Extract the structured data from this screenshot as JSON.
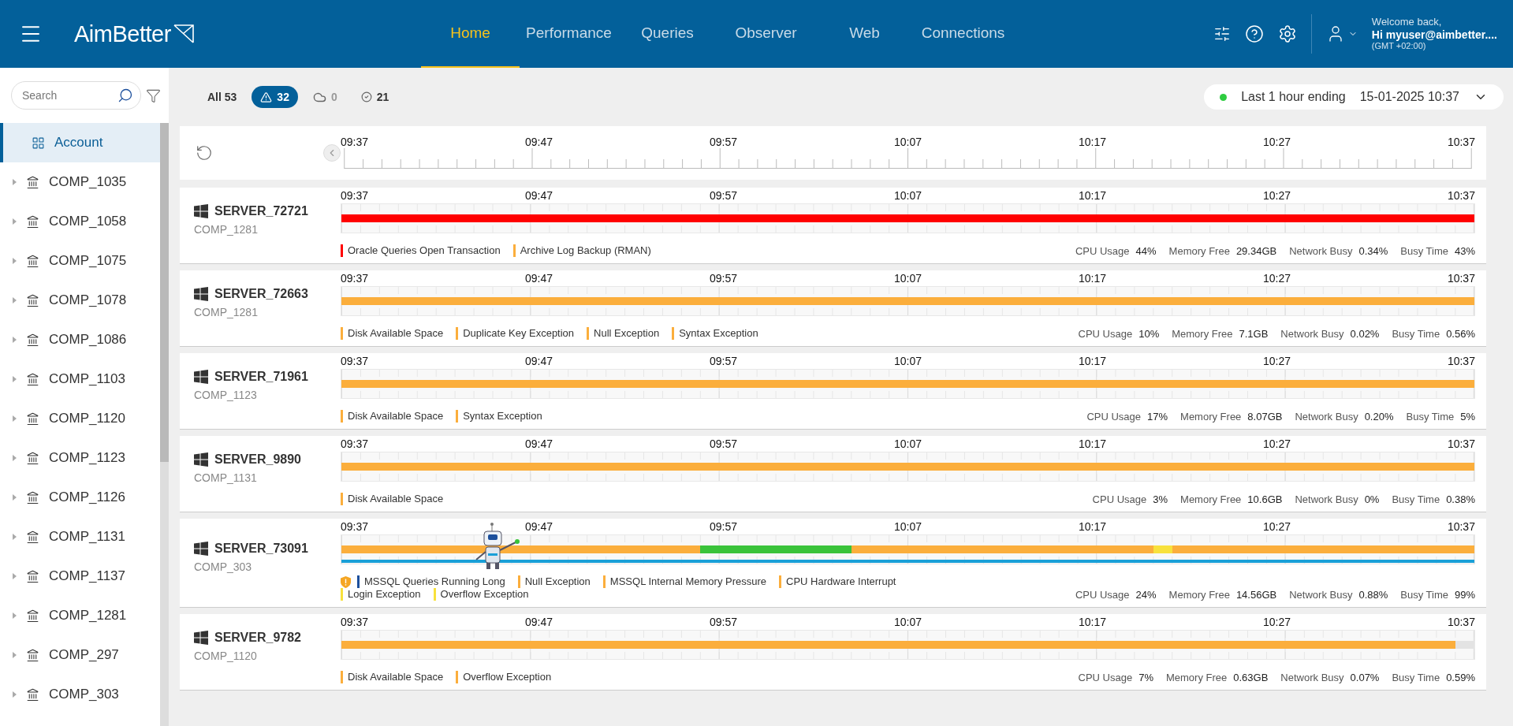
{
  "header": {
    "logo": "AimBetter",
    "nav": [
      {
        "label": "Home",
        "selected": true
      },
      {
        "label": "Performance",
        "selected": false
      },
      {
        "label": "Queries",
        "selected": false
      },
      {
        "label": "Observer",
        "selected": false
      },
      {
        "label": "Web",
        "selected": false
      },
      {
        "label": "Connections",
        "selected": false
      }
    ],
    "user": {
      "greeting": "Welcome back,",
      "name": "Hi myuser@aimbetter....",
      "timezone": "(GMT +02:00)"
    }
  },
  "sidebar": {
    "search": {
      "placeholder": "Search"
    },
    "items": [
      {
        "label": "Account",
        "kind": "account",
        "selected": true
      },
      {
        "label": "COMP_1035",
        "kind": "company",
        "selected": false
      },
      {
        "label": "COMP_1058",
        "kind": "company",
        "selected": false
      },
      {
        "label": "COMP_1075",
        "kind": "company",
        "selected": false
      },
      {
        "label": "COMP_1078",
        "kind": "company",
        "selected": false
      },
      {
        "label": "COMP_1086",
        "kind": "company",
        "selected": false
      },
      {
        "label": "COMP_1103",
        "kind": "company",
        "selected": false
      },
      {
        "label": "COMP_1120",
        "kind": "company",
        "selected": false
      },
      {
        "label": "COMP_1123",
        "kind": "company",
        "selected": false
      },
      {
        "label": "COMP_1126",
        "kind": "company",
        "selected": false
      },
      {
        "label": "COMP_1131",
        "kind": "company",
        "selected": false
      },
      {
        "label": "COMP_1137",
        "kind": "company",
        "selected": false
      },
      {
        "label": "COMP_1281",
        "kind": "company",
        "selected": false
      },
      {
        "label": "COMP_297",
        "kind": "company",
        "selected": false
      },
      {
        "label": "COMP_303",
        "kind": "company",
        "selected": false
      }
    ]
  },
  "filters": [
    {
      "kind": "all",
      "label": "All 53",
      "selected": false,
      "disabled": false
    },
    {
      "kind": "alert",
      "label": "32",
      "selected": true,
      "disabled": false
    },
    {
      "kind": "cloud",
      "label": "0",
      "selected": false,
      "disabled": true
    },
    {
      "kind": "ok",
      "label": "21",
      "selected": false,
      "disabled": false
    }
  ],
  "time_range": {
    "label": "Last 1 hour ending",
    "value": "15-01-2025 10:37",
    "live": true
  },
  "timeline": {
    "labels": [
      "09:37",
      "09:47",
      "09:57",
      "10:07",
      "10:17",
      "10:27",
      "10:37"
    ]
  },
  "servers": [
    {
      "name": "SERVER_72721",
      "company": "COMP_1281",
      "time_labels": [
        "09:37",
        "09:47",
        "09:57",
        "10:07",
        "10:17",
        "10:27",
        "10:37"
      ],
      "segments": [
        {
          "color": "#ff0000"
        },
        {
          "color": "#ff0000"
        },
        {
          "color": "#ff0000"
        },
        {
          "color": "#ff0000"
        },
        {
          "color": "#ff0000"
        },
        {
          "color": "#ff0000"
        },
        {
          "color": "#ff0000"
        },
        {
          "color": "#ff0000"
        },
        {
          "color": "#ff0000"
        },
        {
          "color": "#ff0000"
        },
        {
          "color": "#ff0000"
        },
        {
          "color": "#ff0000"
        },
        {
          "color": "#ff0000"
        },
        {
          "color": "#ff0000"
        },
        {
          "color": "#ff0000"
        },
        {
          "color": "#ff0000"
        },
        {
          "color": "#ff0000"
        },
        {
          "color": "#ff0000"
        },
        {
          "color": "#ff0000"
        },
        {
          "color": "#ff0000"
        },
        {
          "color": "#ff0000"
        },
        {
          "color": "#ff0000"
        },
        {
          "color": "#ff0000"
        },
        {
          "color": "#ff0000"
        },
        {
          "color": "#ff0000"
        },
        {
          "color": "#ff0000"
        },
        {
          "color": "#ff0000"
        },
        {
          "color": "#ff0000"
        },
        {
          "color": "#ff0000"
        },
        {
          "color": "#ff0000"
        },
        {
          "color": "#ff0000"
        },
        {
          "color": "#ff0000"
        },
        {
          "color": "#ff0000"
        },
        {
          "color": "#ff0000"
        },
        {
          "color": "#ff0000"
        },
        {
          "color": "#ff0000"
        },
        {
          "color": "#ff0000"
        },
        {
          "color": "#ff0000"
        },
        {
          "color": "#ff0000"
        },
        {
          "color": "#ff0000"
        },
        {
          "color": "#ff0000"
        },
        {
          "color": "#ff0000"
        },
        {
          "color": "#ff0000"
        },
        {
          "color": "#ff0000"
        },
        {
          "color": "#ff0000"
        },
        {
          "color": "#ff0000"
        },
        {
          "color": "#ff0000"
        },
        {
          "color": "#ff0000"
        },
        {
          "color": "#ff0000"
        },
        {
          "color": "#ff0000"
        },
        {
          "color": "#ff0000"
        },
        {
          "color": "#ff0000"
        },
        {
          "color": "#ff0000"
        },
        {
          "color": "#ff0000"
        },
        {
          "color": "#ff0000"
        },
        {
          "color": "#ff0000"
        },
        {
          "color": "#ff0000"
        },
        {
          "color": "#ff0000"
        },
        {
          "color": "#ff0000"
        },
        {
          "color": "#ff0000"
        }
      ],
      "alerts": [
        {
          "label": "Oracle Queries Open Transaction",
          "color": "#ff0000"
        },
        {
          "label": "Archive Log Backup (RMAN)",
          "color": "#fbae3c"
        }
      ],
      "stats": [
        {
          "label": "CPU Usage",
          "value": "44%"
        },
        {
          "label": "Memory Free",
          "value": "29.34GB"
        },
        {
          "label": "Network Busy",
          "value": "0.34%"
        },
        {
          "label": "Busy Time",
          "value": "43%"
        }
      ]
    },
    {
      "name": "SERVER_72663",
      "company": "COMP_1281",
      "time_labels": [
        "09:37",
        "09:47",
        "09:57",
        "10:07",
        "10:17",
        "10:27",
        "10:37"
      ],
      "segments": [
        {
          "color": "#fbae3c"
        },
        {
          "color": "#fbae3c"
        },
        {
          "color": "#fbae3c"
        },
        {
          "color": "#fbae3c"
        },
        {
          "color": "#fbae3c"
        },
        {
          "color": "#fbae3c"
        },
        {
          "color": "#fbae3c"
        },
        {
          "color": "#fbae3c"
        },
        {
          "color": "#fbae3c"
        },
        {
          "color": "#fbae3c"
        },
        {
          "color": "#fbae3c"
        },
        {
          "color": "#fbae3c"
        },
        {
          "color": "#fbae3c"
        },
        {
          "color": "#fbae3c"
        },
        {
          "color": "#fbae3c"
        },
        {
          "color": "#fbae3c"
        },
        {
          "color": "#fbae3c"
        },
        {
          "color": "#fbae3c"
        },
        {
          "color": "#fbae3c"
        },
        {
          "color": "#fbae3c"
        },
        {
          "color": "#fbae3c"
        },
        {
          "color": "#fbae3c"
        },
        {
          "color": "#fbae3c"
        },
        {
          "color": "#fbae3c"
        },
        {
          "color": "#fbae3c"
        },
        {
          "color": "#fbae3c"
        },
        {
          "color": "#fbae3c"
        },
        {
          "color": "#fbae3c"
        },
        {
          "color": "#fbae3c"
        },
        {
          "color": "#fbae3c"
        },
        {
          "color": "#fbae3c"
        },
        {
          "color": "#fbae3c"
        },
        {
          "color": "#fbae3c"
        },
        {
          "color": "#fbae3c"
        },
        {
          "color": "#fbae3c"
        },
        {
          "color": "#fbae3c"
        },
        {
          "color": "#fbae3c"
        },
        {
          "color": "#fbae3c"
        },
        {
          "color": "#fbae3c"
        },
        {
          "color": "#fbae3c"
        },
        {
          "color": "#fbae3c"
        },
        {
          "color": "#fbae3c"
        },
        {
          "color": "#fbae3c"
        },
        {
          "color": "#fbae3c"
        },
        {
          "color": "#fbae3c"
        },
        {
          "color": "#fbae3c"
        },
        {
          "color": "#fbae3c"
        },
        {
          "color": "#fbae3c"
        },
        {
          "color": "#fbae3c"
        },
        {
          "color": "#fbae3c"
        },
        {
          "color": "#fbae3c"
        },
        {
          "color": "#fbae3c"
        },
        {
          "color": "#fbae3c"
        },
        {
          "color": "#fbae3c"
        },
        {
          "color": "#fbae3c"
        },
        {
          "color": "#fbae3c"
        },
        {
          "color": "#fbae3c"
        },
        {
          "color": "#fbae3c"
        },
        {
          "color": "#fbae3c"
        },
        {
          "color": "#fbae3c"
        }
      ],
      "alerts": [
        {
          "label": "Disk Available Space",
          "color": "#fbae3c"
        },
        {
          "label": "Duplicate Key Exception",
          "color": "#fbae3c"
        },
        {
          "label": "Null Exception",
          "color": "#fbae3c"
        },
        {
          "label": "Syntax Exception",
          "color": "#fbae3c"
        }
      ],
      "stats": [
        {
          "label": "CPU Usage",
          "value": "10%"
        },
        {
          "label": "Memory Free",
          "value": "7.1GB"
        },
        {
          "label": "Network Busy",
          "value": "0.02%"
        },
        {
          "label": "Busy Time",
          "value": "0.56%"
        }
      ]
    },
    {
      "name": "SERVER_71961",
      "company": "COMP_1123",
      "time_labels": [
        "09:37",
        "09:47",
        "09:57",
        "10:07",
        "10:17",
        "10:27",
        "10:37"
      ],
      "segments": [
        {
          "color": "#fbae3c"
        },
        {
          "color": "#fbae3c"
        },
        {
          "color": "#fbae3c"
        },
        {
          "color": "#fbae3c"
        },
        {
          "color": "#fbae3c"
        },
        {
          "color": "#fbae3c"
        },
        {
          "color": "#fbae3c"
        },
        {
          "color": "#fbae3c"
        },
        {
          "color": "#fbae3c"
        },
        {
          "color": "#fbae3c"
        },
        {
          "color": "#fbae3c"
        },
        {
          "color": "#fbae3c"
        },
        {
          "color": "#fbae3c"
        },
        {
          "color": "#fbae3c"
        },
        {
          "color": "#fbae3c"
        },
        {
          "color": "#fbae3c"
        },
        {
          "color": "#fbae3c"
        },
        {
          "color": "#fbae3c"
        },
        {
          "color": "#fbae3c"
        },
        {
          "color": "#fbae3c"
        },
        {
          "color": "#fbae3c"
        },
        {
          "color": "#fbae3c"
        },
        {
          "color": "#fbae3c"
        },
        {
          "color": "#fbae3c"
        },
        {
          "color": "#fbae3c"
        },
        {
          "color": "#fbae3c"
        },
        {
          "color": "#fbae3c"
        },
        {
          "color": "#fbae3c"
        },
        {
          "color": "#fbae3c"
        },
        {
          "color": "#fbae3c"
        },
        {
          "color": "#fbae3c"
        },
        {
          "color": "#fbae3c"
        },
        {
          "color": "#fbae3c"
        },
        {
          "color": "#fbae3c"
        },
        {
          "color": "#fbae3c"
        },
        {
          "color": "#fbae3c"
        },
        {
          "color": "#fbae3c"
        },
        {
          "color": "#fbae3c"
        },
        {
          "color": "#fbae3c"
        },
        {
          "color": "#fbae3c"
        },
        {
          "color": "#fbae3c"
        },
        {
          "color": "#fbae3c"
        },
        {
          "color": "#fbae3c"
        },
        {
          "color": "#fbae3c"
        },
        {
          "color": "#fbae3c"
        },
        {
          "color": "#fbae3c"
        },
        {
          "color": "#fbae3c"
        },
        {
          "color": "#fbae3c"
        },
        {
          "color": "#fbae3c"
        },
        {
          "color": "#fbae3c"
        },
        {
          "color": "#fbae3c"
        },
        {
          "color": "#fbae3c"
        },
        {
          "color": "#fbae3c"
        },
        {
          "color": "#fbae3c"
        },
        {
          "color": "#fbae3c"
        },
        {
          "color": "#fbae3c"
        },
        {
          "color": "#fbae3c"
        },
        {
          "color": "#fbae3c"
        },
        {
          "color": "#fbae3c"
        },
        {
          "color": "#fbae3c"
        }
      ],
      "alerts": [
        {
          "label": "Disk Available Space",
          "color": "#fbae3c"
        },
        {
          "label": "Syntax Exception",
          "color": "#fbae3c"
        }
      ],
      "stats": [
        {
          "label": "CPU Usage",
          "value": "17%"
        },
        {
          "label": "Memory Free",
          "value": "8.07GB"
        },
        {
          "label": "Network Busy",
          "value": "0.20%"
        },
        {
          "label": "Busy Time",
          "value": "5%"
        }
      ]
    },
    {
      "name": "SERVER_9890",
      "company": "COMP_1131",
      "time_labels": [
        "09:37",
        "09:47",
        "09:57",
        "10:07",
        "10:17",
        "10:27",
        "10:37"
      ],
      "segments": [
        {
          "color": "#fbae3c"
        },
        {
          "color": "#fbae3c"
        },
        {
          "color": "#fbae3c"
        },
        {
          "color": "#fbae3c"
        },
        {
          "color": "#fbae3c"
        },
        {
          "color": "#fbae3c"
        },
        {
          "color": "#fbae3c"
        },
        {
          "color": "#fbae3c"
        },
        {
          "color": "#fbae3c"
        },
        {
          "color": "#fbae3c"
        },
        {
          "color": "#fbae3c"
        },
        {
          "color": "#fbae3c"
        },
        {
          "color": "#fbae3c"
        },
        {
          "color": "#fbae3c"
        },
        {
          "color": "#fbae3c"
        },
        {
          "color": "#fbae3c"
        },
        {
          "color": "#fbae3c"
        },
        {
          "color": "#fbae3c"
        },
        {
          "color": "#fbae3c"
        },
        {
          "color": "#fbae3c"
        },
        {
          "color": "#fbae3c"
        },
        {
          "color": "#fbae3c"
        },
        {
          "color": "#fbae3c"
        },
        {
          "color": "#fbae3c"
        },
        {
          "color": "#fbae3c"
        },
        {
          "color": "#fbae3c"
        },
        {
          "color": "#fbae3c"
        },
        {
          "color": "#fbae3c"
        },
        {
          "color": "#fbae3c"
        },
        {
          "color": "#fbae3c"
        },
        {
          "color": "#fbae3c"
        },
        {
          "color": "#fbae3c"
        },
        {
          "color": "#fbae3c"
        },
        {
          "color": "#fbae3c"
        },
        {
          "color": "#fbae3c"
        },
        {
          "color": "#fbae3c"
        },
        {
          "color": "#fbae3c"
        },
        {
          "color": "#fbae3c"
        },
        {
          "color": "#fbae3c"
        },
        {
          "color": "#fbae3c"
        },
        {
          "color": "#fbae3c"
        },
        {
          "color": "#fbae3c"
        },
        {
          "color": "#fbae3c"
        },
        {
          "color": "#fbae3c"
        },
        {
          "color": "#fbae3c"
        },
        {
          "color": "#fbae3c"
        },
        {
          "color": "#fbae3c"
        },
        {
          "color": "#fbae3c"
        },
        {
          "color": "#fbae3c"
        },
        {
          "color": "#fbae3c"
        },
        {
          "color": "#fbae3c"
        },
        {
          "color": "#fbae3c"
        },
        {
          "color": "#fbae3c"
        },
        {
          "color": "#fbae3c"
        },
        {
          "color": "#fbae3c"
        },
        {
          "color": "#fbae3c"
        },
        {
          "color": "#fbae3c"
        },
        {
          "color": "#fbae3c"
        },
        {
          "color": "#fbae3c"
        },
        {
          "color": "#fbae3c"
        }
      ],
      "alerts": [
        {
          "label": "Disk Available Space",
          "color": "#fbae3c"
        }
      ],
      "stats": [
        {
          "label": "CPU Usage",
          "value": "3%"
        },
        {
          "label": "Memory Free",
          "value": "10.6GB"
        },
        {
          "label": "Network Busy",
          "value": "0%"
        },
        {
          "label": "Busy Time",
          "value": "0.38%"
        }
      ]
    },
    {
      "name": "SERVER_73091",
      "company": "COMP_303",
      "time_labels": [
        "09:37",
        "09:47",
        "09:57",
        "10:07",
        "10:17",
        "10:27",
        "10:37"
      ],
      "assistant": true,
      "activity_line": true,
      "warning": true,
      "segments": [
        {
          "color": "#fbae3c"
        },
        {
          "color": "#fbae3c"
        },
        {
          "color": "#fbae3c"
        },
        {
          "color": "#fbae3c"
        },
        {
          "color": "#fbae3c"
        },
        {
          "color": "#fbae3c"
        },
        {
          "color": "#fbae3c"
        },
        {
          "color": "#fbae3c"
        },
        {
          "color": "#fbae3c"
        },
        {
          "color": "#fbae3c"
        },
        {
          "color": "#fbae3c"
        },
        {
          "color": "#fbae3c"
        },
        {
          "color": "#fbae3c"
        },
        {
          "color": "#fbae3c"
        },
        {
          "color": "#fbae3c"
        },
        {
          "color": "#fbae3c"
        },
        {
          "color": "#fbae3c"
        },
        {
          "color": "#fbae3c"
        },
        {
          "color": "#fbae3c"
        },
        {
          "color": "#3ac33a"
        },
        {
          "color": "#3ac33a"
        },
        {
          "color": "#3ac33a"
        },
        {
          "color": "#3ac33a"
        },
        {
          "color": "#3ac33a"
        },
        {
          "color": "#3ac33a"
        },
        {
          "color": "#3ac33a"
        },
        {
          "color": "#3ac33a"
        },
        {
          "color": "#fbae3c"
        },
        {
          "color": "#fbae3c"
        },
        {
          "color": "#fbae3c"
        },
        {
          "color": "#fbae3c"
        },
        {
          "color": "#fbae3c"
        },
        {
          "color": "#fbae3c"
        },
        {
          "color": "#fbae3c"
        },
        {
          "color": "#fbae3c"
        },
        {
          "color": "#fbae3c"
        },
        {
          "color": "#fbae3c"
        },
        {
          "color": "#fbae3c"
        },
        {
          "color": "#fbae3c"
        },
        {
          "color": "#fbae3c"
        },
        {
          "color": "#fbae3c"
        },
        {
          "color": "#fbae3c"
        },
        {
          "color": "#fbae3c"
        },
        {
          "color": "#f8e13c"
        },
        {
          "color": "#fbae3c"
        },
        {
          "color": "#fbae3c"
        },
        {
          "color": "#fbae3c"
        },
        {
          "color": "#fbae3c"
        },
        {
          "color": "#fbae3c"
        },
        {
          "color": "#fbae3c"
        },
        {
          "color": "#fbae3c"
        },
        {
          "color": "#fbae3c"
        },
        {
          "color": "#fbae3c"
        },
        {
          "color": "#fbae3c"
        },
        {
          "color": "#fbae3c"
        },
        {
          "color": "#fbae3c"
        },
        {
          "color": "#fbae3c"
        },
        {
          "color": "#fbae3c"
        },
        {
          "color": "#fbae3c"
        },
        {
          "color": "#fbae3c"
        }
      ],
      "alerts": [
        {
          "label": "MSSQL Queries Running Long",
          "color": "#1c4f9c"
        },
        {
          "label": "Null Exception",
          "color": "#fbae3c"
        },
        {
          "label": "MSSQL Internal Memory Pressure",
          "color": "#fbae3c"
        },
        {
          "label": "CPU Hardware Interrupt",
          "color": "#fbae3c"
        },
        {
          "label": "Login Exception",
          "color": "#f8e13c"
        },
        {
          "label": "Overflow Exception",
          "color": "#f8e13c"
        }
      ],
      "stats": [
        {
          "label": "CPU Usage",
          "value": "24%"
        },
        {
          "label": "Memory Free",
          "value": "14.56GB"
        },
        {
          "label": "Network Busy",
          "value": "0.88%"
        },
        {
          "label": "Busy Time",
          "value": "99%"
        }
      ]
    },
    {
      "name": "SERVER_9782",
      "company": "COMP_1120",
      "time_labels": [
        "09:37",
        "09:47",
        "09:57",
        "10:07",
        "10:17",
        "10:27",
        "10:37"
      ],
      "segments": [
        {
          "color": "#fbae3c"
        },
        {
          "color": "#fbae3c"
        },
        {
          "color": "#fbae3c"
        },
        {
          "color": "#fbae3c"
        },
        {
          "color": "#fbae3c"
        },
        {
          "color": "#fbae3c"
        },
        {
          "color": "#fbae3c"
        },
        {
          "color": "#fbae3c"
        },
        {
          "color": "#fbae3c"
        },
        {
          "color": "#fbae3c"
        },
        {
          "color": "#fbae3c"
        },
        {
          "color": "#fbae3c"
        },
        {
          "color": "#fbae3c"
        },
        {
          "color": "#fbae3c"
        },
        {
          "color": "#fbae3c"
        },
        {
          "color": "#fbae3c"
        },
        {
          "color": "#fbae3c"
        },
        {
          "color": "#fbae3c"
        },
        {
          "color": "#fbae3c"
        },
        {
          "color": "#fbae3c"
        },
        {
          "color": "#fbae3c"
        },
        {
          "color": "#fbae3c"
        },
        {
          "color": "#fbae3c"
        },
        {
          "color": "#fbae3c"
        },
        {
          "color": "#fbae3c"
        },
        {
          "color": "#fbae3c"
        },
        {
          "color": "#fbae3c"
        },
        {
          "color": "#fbae3c"
        },
        {
          "color": "#fbae3c"
        },
        {
          "color": "#fbae3c"
        },
        {
          "color": "#fbae3c"
        },
        {
          "color": "#fbae3c"
        },
        {
          "color": "#fbae3c"
        },
        {
          "color": "#fbae3c"
        },
        {
          "color": "#fbae3c"
        },
        {
          "color": "#fbae3c"
        },
        {
          "color": "#fbae3c"
        },
        {
          "color": "#fbae3c"
        },
        {
          "color": "#fbae3c"
        },
        {
          "color": "#fbae3c"
        },
        {
          "color": "#fbae3c"
        },
        {
          "color": "#fbae3c"
        },
        {
          "color": "#fbae3c"
        },
        {
          "color": "#fbae3c"
        },
        {
          "color": "#fbae3c"
        },
        {
          "color": "#fbae3c"
        },
        {
          "color": "#fbae3c"
        },
        {
          "color": "#fbae3c"
        },
        {
          "color": "#fbae3c"
        },
        {
          "color": "#fbae3c"
        },
        {
          "color": "#fbae3c"
        },
        {
          "color": "#fbae3c"
        },
        {
          "color": "#fbae3c"
        },
        {
          "color": "#fbae3c"
        },
        {
          "color": "#fbae3c"
        },
        {
          "color": "#fbae3c"
        },
        {
          "color": "#fbae3c"
        },
        {
          "color": "#fbae3c"
        },
        {
          "color": "#fbae3c"
        },
        {
          "color": "#e3e3e3"
        }
      ],
      "alerts": [
        {
          "label": "Disk Available Space",
          "color": "#fbae3c"
        },
        {
          "label": "Overflow Exception",
          "color": "#fbae3c"
        }
      ],
      "stats": [
        {
          "label": "CPU Usage",
          "value": "7%"
        },
        {
          "label": "Memory Free",
          "value": "0.63GB"
        },
        {
          "label": "Network Busy",
          "value": "0.07%"
        },
        {
          "label": "Busy Time",
          "value": "0.59%"
        }
      ]
    }
  ]
}
